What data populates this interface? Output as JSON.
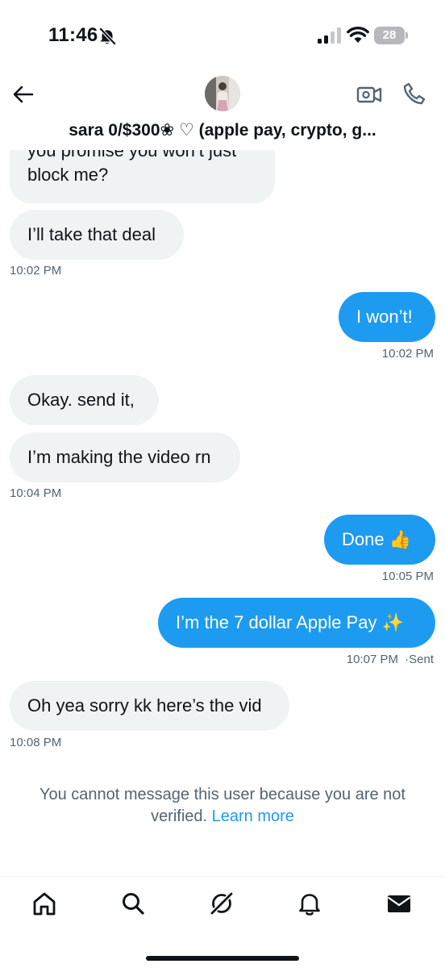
{
  "status_bar": {
    "time": "11:46",
    "battery": "28"
  },
  "header": {
    "contact_name": "sara 0/$300❀ ♡ (apple pay, crypto, g..."
  },
  "messages": [
    {
      "text_lines": [
        "you promise you won’t just",
        "block me?"
      ],
      "direction": "in"
    },
    {
      "text": "I’ll take that deal",
      "direction": "in"
    },
    {
      "time": "10:02 PM"
    },
    {
      "text": "I won’t!",
      "direction": "out"
    },
    {
      "time": "10:02 PM"
    },
    {
      "text": "Okay. send it,",
      "direction": "in"
    },
    {
      "text": "I’m making the video rn",
      "direction": "in"
    },
    {
      "time": "10:04 PM"
    },
    {
      "text": "Done 👍",
      "direction": "out"
    },
    {
      "time": "10:05 PM"
    },
    {
      "text": "I’m the 7 dollar Apple Pay ✨",
      "direction": "out"
    },
    {
      "time": "10:07 PM",
      "status": "·Sent"
    },
    {
      "text": "Oh yea sorry kk here’s the vid",
      "direction": "in"
    },
    {
      "time": "10:08 PM"
    }
  ],
  "notice": {
    "text": "You cannot message this user because you are not verified.",
    "link": "Learn more"
  },
  "colors": {
    "accent": "#1d9bf0",
    "incoming_bubble": "#eff3f4",
    "muted_text": "#536471"
  },
  "icons": {
    "status": [
      "bell-off-icon",
      "signal-icon",
      "wifi-icon",
      "battery-icon"
    ],
    "header": [
      "back-arrow-icon",
      "video-call-icon",
      "phone-icon"
    ],
    "nav": [
      "home-icon",
      "search-icon",
      "grok-icon",
      "notifications-icon",
      "messages-icon"
    ]
  }
}
